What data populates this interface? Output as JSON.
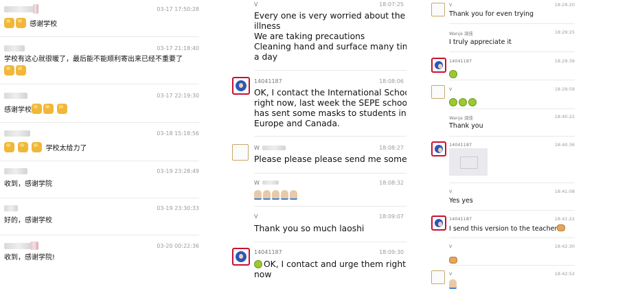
{
  "column1": {
    "messages": [
      {
        "time": "03-17 17:50:28",
        "text": "感谢学校",
        "thumbs_before": 2,
        "thumbs_after": 0
      },
      {
        "time": "03-17 21:18:40",
        "text": "学校有这心就很暖了，最后能不能顺利寄出来已经不重要了",
        "thumbs_before": 0,
        "thumbs_after": 2
      },
      {
        "time": "03-17 22:19:30",
        "text": "感谢学校",
        "thumbs_before": 0,
        "thumbs_after": 3
      },
      {
        "time": "03-18 15:18:56",
        "text": "学校太给力了",
        "thumbs_before": 3,
        "thumbs_after": 0
      },
      {
        "time": "03-19 23:28:49",
        "text": "收到，感谢学院",
        "thumbs_before": 0,
        "thumbs_after": 0
      },
      {
        "time": "03-19 23:30:33",
        "text": "好的，感谢学校",
        "thumbs_before": 0,
        "thumbs_after": 0
      },
      {
        "time": "03-20 00:22:36",
        "text": "收到，感谢学院!",
        "thumbs_before": 0,
        "thumbs_after": 0
      }
    ]
  },
  "column2": {
    "messages": [
      {
        "name": "V",
        "time": "18:07:25",
        "lines": [
          "Every one is very worried about the",
          "illness",
          "We are taking precautions",
          "Cleaning hand and surface many times",
          "a day"
        ]
      },
      {
        "name": "14041187",
        "time": "18:08:06",
        "lines": [
          "OK, I contact the International School",
          "right now, last week the SEPE school",
          "has sent some masks to students in",
          "Europe and Canada."
        ]
      },
      {
        "name": "W",
        "time": "18:08:27",
        "lines": [
          "Please please please send me some"
        ]
      },
      {
        "name": "W",
        "time": "18:08:32",
        "lines": []
      },
      {
        "name": "V",
        "time": "18:09:07",
        "lines": [
          "Thank you so much laoshi"
        ]
      },
      {
        "name": "14041187",
        "time": "18:09:30",
        "lines": [
          "OK, I contact and urge them right",
          "now"
        ]
      }
    ]
  },
  "column3": {
    "messages": [
      {
        "name": "V",
        "time": "18:29:20",
        "text": "Thank you for even trying"
      },
      {
        "name": "Wanja  润佳",
        "time": "18:29:25",
        "text": "I truly appreciate it"
      },
      {
        "name": "14041187",
        "time": "18:29:39",
        "text": ""
      },
      {
        "name": "V",
        "time": "18:29:59",
        "text": ""
      },
      {
        "name": "Wanja  润佳",
        "time": "18:40:22",
        "text": "Thank you"
      },
      {
        "name": "14041187",
        "time": "18:40:36",
        "text": ""
      },
      {
        "name": "V",
        "time": "18:41:08",
        "text": "Yes yes"
      },
      {
        "name": "14041187",
        "time": "18:41:22",
        "text": "I send this version to the  teacher"
      },
      {
        "name": "V",
        "time": "18:42:30",
        "text": ""
      },
      {
        "name": "V",
        "time": "18:42:52",
        "text": ""
      }
    ]
  }
}
